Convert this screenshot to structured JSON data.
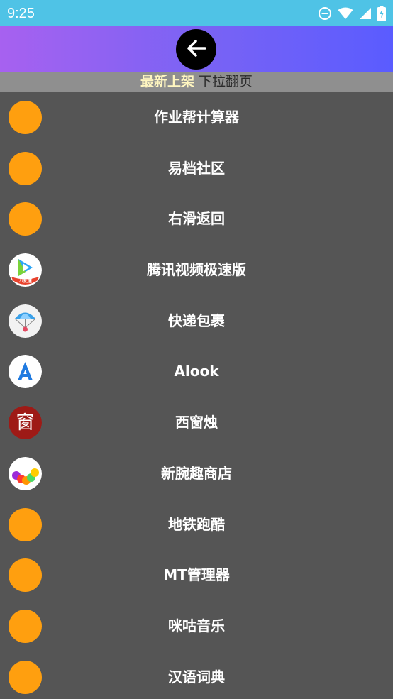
{
  "status_bar": {
    "time": "9:25",
    "icons": [
      "do-not-disturb-icon",
      "wifi-icon",
      "signal-icon",
      "battery-charging-icon"
    ]
  },
  "header": {
    "back_icon": "arrow-left-icon",
    "gradient": [
      "#a761f0",
      "#5a5cff"
    ]
  },
  "banner": {
    "title": "最新上架",
    "hint": "下拉翻页"
  },
  "colors": {
    "status_bar": "#4fc3e6",
    "background": "#555555",
    "banner": "#8f8f8f",
    "placeholder_icon": "#ff9f0f"
  },
  "apps": [
    {
      "name": "作业帮计算器",
      "icon": "placeholder-icon"
    },
    {
      "name": "易档社区",
      "icon": "placeholder-icon"
    },
    {
      "name": "右滑返回",
      "icon": "placeholder-icon"
    },
    {
      "name": "腾讯视频极速版",
      "icon": "tencent-video-icon"
    },
    {
      "name": "快递包裹",
      "icon": "parachute-icon"
    },
    {
      "name": "Alook",
      "icon": "alook-icon"
    },
    {
      "name": "西窗烛",
      "icon": "xichuangzhu-icon"
    },
    {
      "name": "新腕趣商店",
      "icon": "colorful-dots-icon"
    },
    {
      "name": "地铁跑酷",
      "icon": "placeholder-icon"
    },
    {
      "name": "MT管理器",
      "icon": "placeholder-icon"
    },
    {
      "name": "咪咕音乐",
      "icon": "placeholder-icon"
    },
    {
      "name": "汉语词典",
      "icon": "placeholder-icon"
    }
  ],
  "icon_text": {
    "tencent_badge": "极速",
    "xichuangzhu_char": "窗"
  }
}
